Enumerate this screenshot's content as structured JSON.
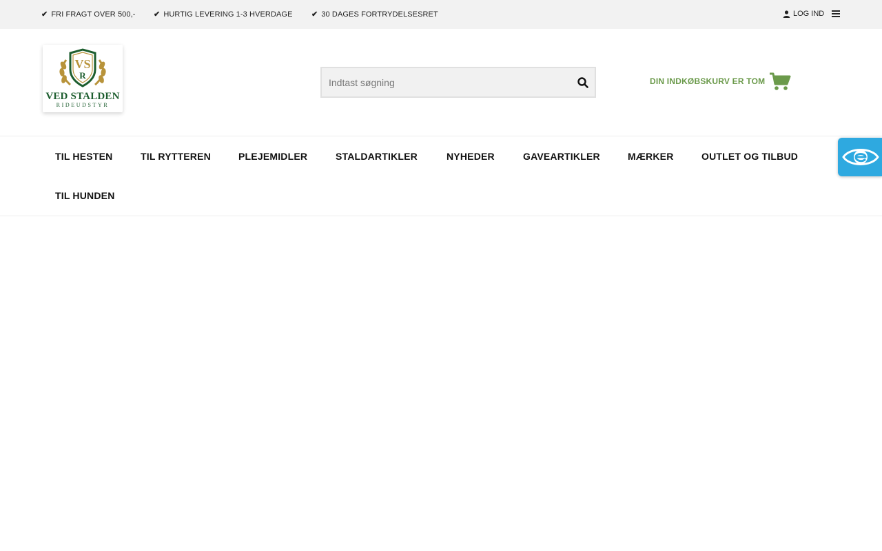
{
  "topbar": {
    "usps": [
      {
        "icon": "check-icon",
        "label": "FRI FRAGT OVER 500,-"
      },
      {
        "icon": "check-icon",
        "label": "HURTIG LEVERING 1-3 HVERDAGE"
      },
      {
        "icon": "check-icon",
        "label": "30 DAGES FORTRYDELSESRET"
      }
    ],
    "login_label": "LOG IND",
    "menu_icon": "hamburger-menu-icon"
  },
  "logo": {
    "monogram": "VS",
    "letter": "R",
    "name": "VED STALDEN",
    "subtitle": "RIDEUDSTYR",
    "colors": {
      "green": "#1d5e2f",
      "gold": "#b8933a"
    }
  },
  "search": {
    "placeholder": "Indtast søgning",
    "value": "",
    "icon": "search-icon"
  },
  "cart": {
    "label": "DIN INDKØBSKURV ER TOM",
    "icon": "shopping-cart-icon",
    "color": "#6b9a4b"
  },
  "nav": {
    "items": [
      {
        "label": "TIL HESTEN"
      },
      {
        "label": "TIL RYTTEREN"
      },
      {
        "label": "PLEJEMIDLER"
      },
      {
        "label": "STALDARTIKLER"
      },
      {
        "label": "NYHEDER"
      },
      {
        "label": "GAVEARTIKLER"
      },
      {
        "label": "MÆRKER"
      },
      {
        "label": "OUTLET OG TILBUD"
      },
      {
        "label": "TIL HUNDEN"
      }
    ]
  },
  "accessibility_widget": {
    "icon": "eye-accessibility-icon",
    "color": "#2ea9e0"
  }
}
